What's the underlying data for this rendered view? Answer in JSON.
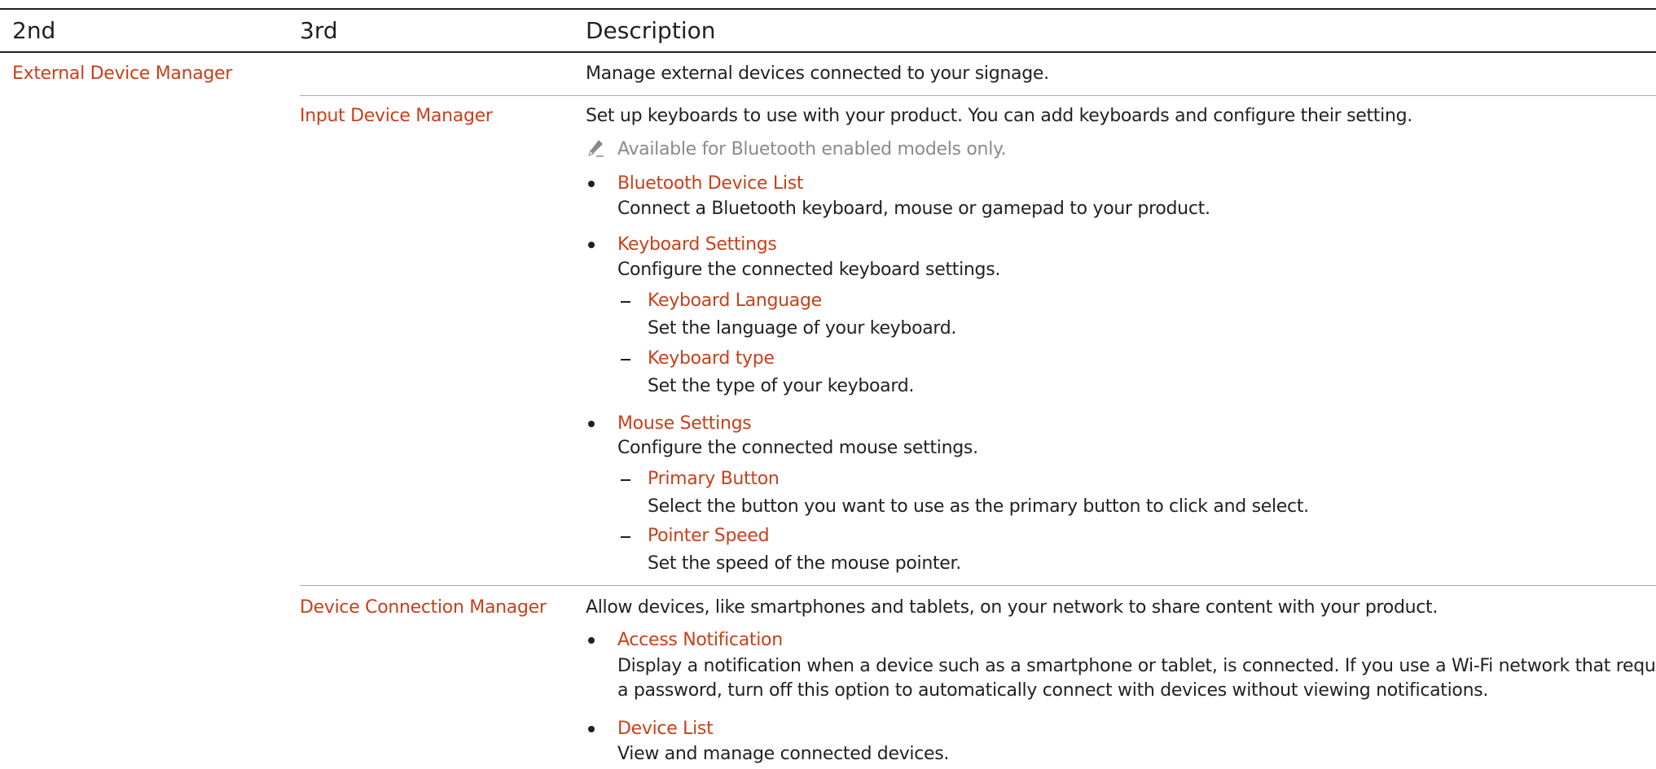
{
  "table": {
    "headers": {
      "col2": "2nd",
      "col3": "3rd",
      "desc": "Description"
    },
    "row1": {
      "second": "External Device Manager",
      "description": "Manage external devices connected to your signage."
    },
    "row2": {
      "third": "Input Device Manager",
      "description": "Set up keyboards to use with your product. You can add keyboards and configure their setting.",
      "note": "Available for Bluetooth enabled models only.",
      "note_icon": "pencil-icon",
      "items": [
        {
          "title": "Bluetooth Device List",
          "text": "Connect a Bluetooth keyboard, mouse or gamepad to your product."
        },
        {
          "title": "Keyboard Settings",
          "text": "Configure the connected keyboard settings.",
          "subitems": [
            {
              "title": "Keyboard Language",
              "text": "Set the language of your keyboard."
            },
            {
              "title": "Keyboard type",
              "text": "Set the type of your keyboard."
            }
          ]
        },
        {
          "title": "Mouse Settings",
          "text": "Configure the connected mouse settings.",
          "subitems": [
            {
              "title": "Primary Button",
              "text": "Select the button you want to use as the primary button to click and select."
            },
            {
              "title": "Pointer Speed",
              "text": "Set the speed of the mouse pointer."
            }
          ]
        }
      ]
    },
    "row3": {
      "third": "Device Connection Manager",
      "description": "Allow devices, like smartphones and tablets, on your network to share content with your product.",
      "items": [
        {
          "title": "Access Notification",
          "text_line1": "Display a notification when a device such as a smartphone or tablet, is connected. If you use a Wi-Fi network that requires",
          "text_line2": "a password, turn off this option to automatically connect with devices without viewing notifications."
        },
        {
          "title": "Device List",
          "text": "View and manage connected devices."
        }
      ]
    }
  },
  "colors": {
    "accent": "#c7401b",
    "text": "#231f20",
    "note": "#8a8a8a",
    "rule_dark": "#231f20",
    "rule_light": "#a7a9ac"
  }
}
